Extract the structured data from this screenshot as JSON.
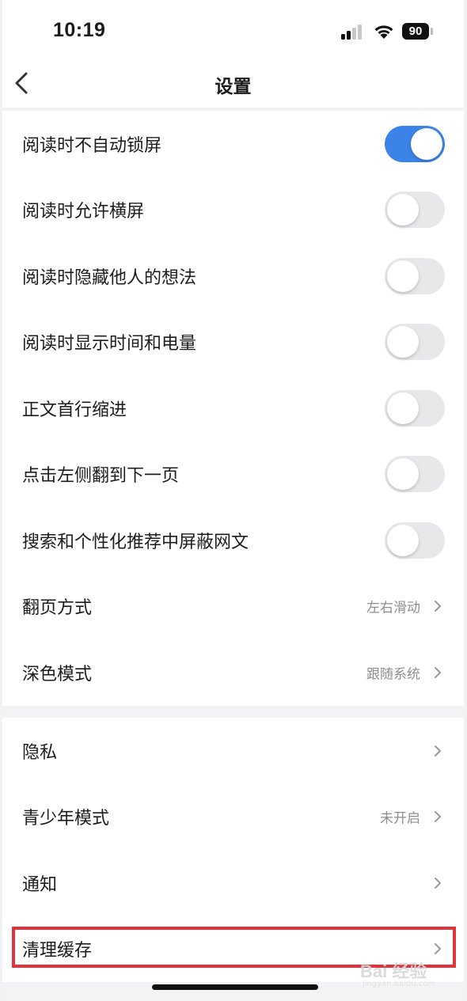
{
  "status_bar": {
    "time": "10:19",
    "battery": "90"
  },
  "nav": {
    "title": "设置"
  },
  "reading_settings": [
    {
      "label": "阅读时不自动锁屏",
      "type": "toggle",
      "on": true
    },
    {
      "label": "阅读时允许横屏",
      "type": "toggle",
      "on": false
    },
    {
      "label": "阅读时隐藏他人的想法",
      "type": "toggle",
      "on": false
    },
    {
      "label": "阅读时显示时间和电量",
      "type": "toggle",
      "on": false
    },
    {
      "label": "正文首行缩进",
      "type": "toggle",
      "on": false
    },
    {
      "label": "点击左侧翻到下一页",
      "type": "toggle",
      "on": false
    },
    {
      "label": "搜索和个性化推荐中屏蔽网文",
      "type": "toggle",
      "on": false
    },
    {
      "label": "翻页方式",
      "type": "link",
      "value": "左右滑动"
    },
    {
      "label": "深色模式",
      "type": "link",
      "value": "跟随系统"
    }
  ],
  "other_settings": [
    {
      "label": "隐私",
      "type": "link",
      "value": ""
    },
    {
      "label": "青少年模式",
      "type": "link",
      "value": "未开启"
    },
    {
      "label": "通知",
      "type": "link",
      "value": ""
    },
    {
      "label": "清理缓存",
      "type": "link",
      "value": ""
    }
  ],
  "watermark": {
    "text": "Bai 经验",
    "sub": "jingyan.baidu.com"
  },
  "colors": {
    "accent": "#3c83e8",
    "highlight": "#e4323b"
  }
}
